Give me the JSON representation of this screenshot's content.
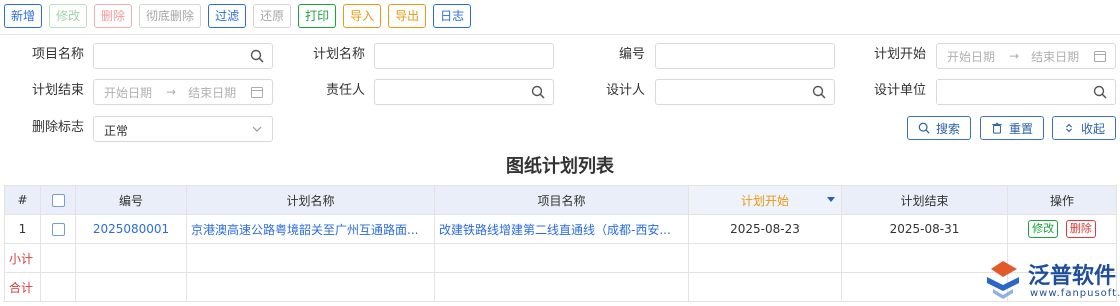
{
  "toolbar": {
    "add": "新增",
    "edit": "修改",
    "delete": "删除",
    "purge": "彻底删除",
    "filter": "过滤",
    "restore": "还原",
    "print": "打印",
    "import": "导入",
    "export": "导出",
    "log": "日志"
  },
  "search": {
    "project_name_label": "项目名称",
    "project_name_value": "",
    "plan_name_label": "计划名称",
    "plan_name_value": "",
    "number_label": "编号",
    "number_value": "",
    "plan_start_label": "计划开始",
    "plan_end_label": "计划结束",
    "start_date_placeholder": "开始日期",
    "end_date_placeholder": "结束日期",
    "range_sep": "→",
    "owner_label": "责任人",
    "owner_value": "",
    "designer_label": "设计人",
    "designer_value": "",
    "design_unit_label": "设计单位",
    "design_unit_value": "",
    "deleted_flag_label": "删除标志",
    "deleted_flag_value": "正常",
    "search_button": "搜索",
    "reset_button": "重置",
    "collapse_button": "收起"
  },
  "table": {
    "title": "图纸计划列表",
    "columns": {
      "index": "#",
      "number": "编号",
      "plan_name": "计划名称",
      "project_name": "项目名称",
      "plan_start": "计划开始",
      "plan_end": "计划结束",
      "actions": "操作"
    },
    "rows": [
      {
        "index": "1",
        "number": "2025080001",
        "plan_name": "京港澳高速公路粤境韶关至广州互通路面...",
        "project_name": "改建铁路线增建第二线直通线（成都-西安...",
        "plan_start": "2025-08-23",
        "plan_end": "2025-08-31",
        "edit": "修改",
        "delete": "删除"
      }
    ],
    "subtotal_label": "小计",
    "total_label": "合计"
  },
  "brand": {
    "name": "泛普软件",
    "url": "www.fanpusoft.com"
  }
}
